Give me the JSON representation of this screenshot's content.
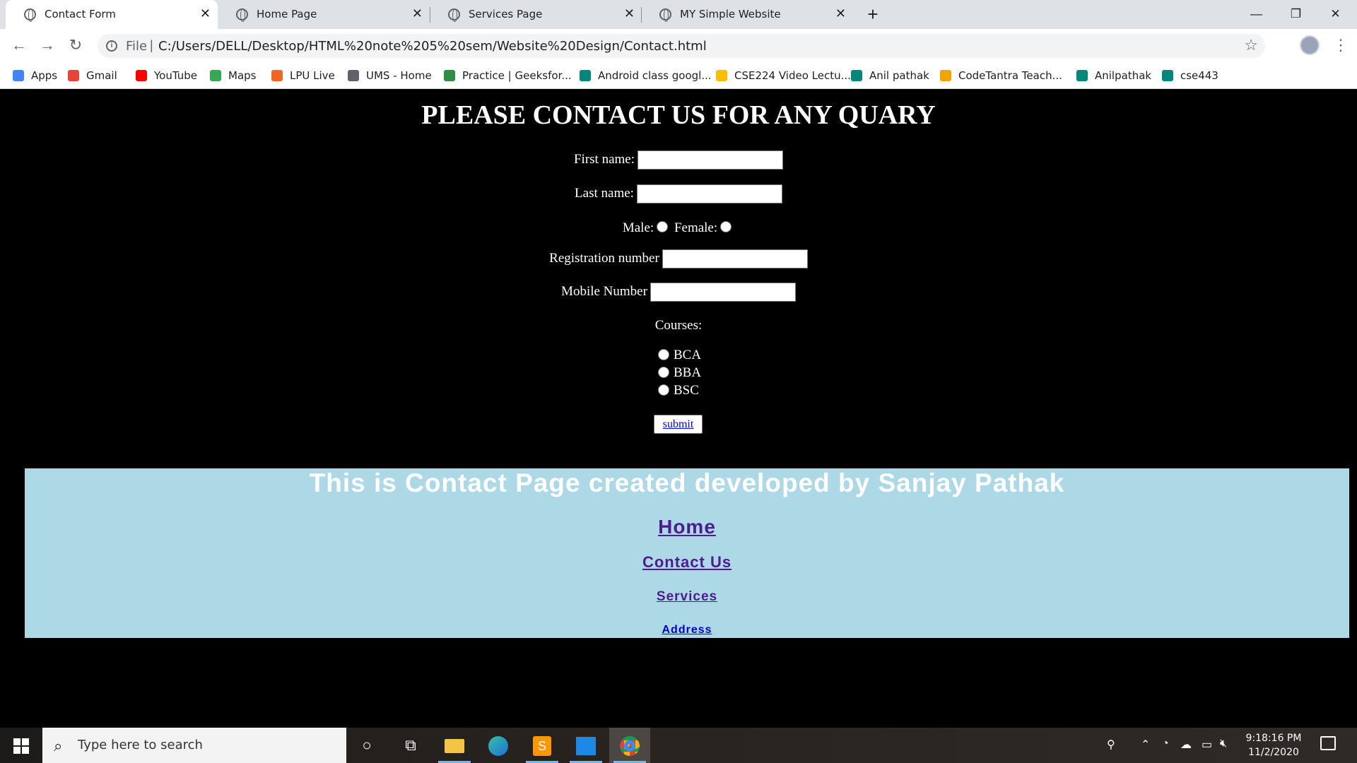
{
  "browser": {
    "tabs": [
      {
        "title": "Contact Form",
        "active": true
      },
      {
        "title": "Home Page",
        "active": false
      },
      {
        "title": "Services Page",
        "active": false
      },
      {
        "title": "MY Simple Website",
        "active": false
      }
    ],
    "new_tab_icon": "plus-icon",
    "window_controls": [
      "minimize-icon",
      "restore-icon",
      "close-icon"
    ],
    "address": {
      "protocol_label": "File",
      "url": "C:/Users/DELL/Desktop/HTML%20note%205%20sem/Website%20Design/Contact.html"
    },
    "bookmarks": [
      {
        "label": "Apps",
        "icon": "apps-grid-icon",
        "color": "#4285f4"
      },
      {
        "label": "Gmail",
        "icon": "gmail-icon",
        "color": "#ea4335"
      },
      {
        "label": "YouTube",
        "icon": "youtube-icon",
        "color": "#ff0000"
      },
      {
        "label": "Maps",
        "icon": "maps-icon",
        "color": "#34a853"
      },
      {
        "label": "LPU Live",
        "icon": "lpu-icon",
        "color": "#f26522"
      },
      {
        "label": "UMS - Home",
        "icon": "globe-icon",
        "color": "#5f6368"
      },
      {
        "label": "Practice | Geeksfor...",
        "icon": "geeksforgeeks-icon",
        "color": "#2f8d46"
      },
      {
        "label": "Android class googl...",
        "icon": "meet-icon",
        "color": "#00897b"
      },
      {
        "label": "CSE224 Video Lectu...",
        "icon": "drive-icon",
        "color": "#fbbc04"
      },
      {
        "label": "Anil pathak",
        "icon": "meet-icon",
        "color": "#00897b"
      },
      {
        "label": "CodeTantra Teach...",
        "icon": "codetantra-icon",
        "color": "#f4a300"
      },
      {
        "label": "Anilpathak",
        "icon": "meet-icon",
        "color": "#00897b"
      },
      {
        "label": "cse443",
        "icon": "meet-icon",
        "color": "#00897b"
      }
    ]
  },
  "page": {
    "heading": "PLEASE CONTACT US FOR ANY QUARY",
    "form": {
      "first_name_label": "First name:",
      "first_name_value": "",
      "last_name_label": "Last name:",
      "last_name_value": "",
      "male_label": "Male:",
      "female_label": "Female:",
      "registration_label": "Registration number",
      "registration_value": "",
      "mobile_label": "Mobile Number",
      "mobile_value": "",
      "courses_label": "Courses:",
      "courses": [
        "BCA",
        "BBA",
        "BSC"
      ],
      "submit_label": "submit"
    },
    "footer": {
      "title": "This is Contact Page created developed by Sanjay Pathak",
      "links": [
        "Home",
        "Contact Us",
        "Services",
        "Address"
      ],
      "background": "#add8e6",
      "link_color": "#4b1d8f",
      "address_link_color": "#0000cc"
    }
  },
  "taskbar": {
    "search_placeholder": "Type here to search",
    "apps": [
      "cortana-icon",
      "task-view-icon",
      "file-explorer-icon",
      "edge-icon",
      "sublime-text-icon",
      "photos-icon",
      "chrome-icon"
    ],
    "time": "9:18:16 PM",
    "date": "11/2/2020"
  }
}
